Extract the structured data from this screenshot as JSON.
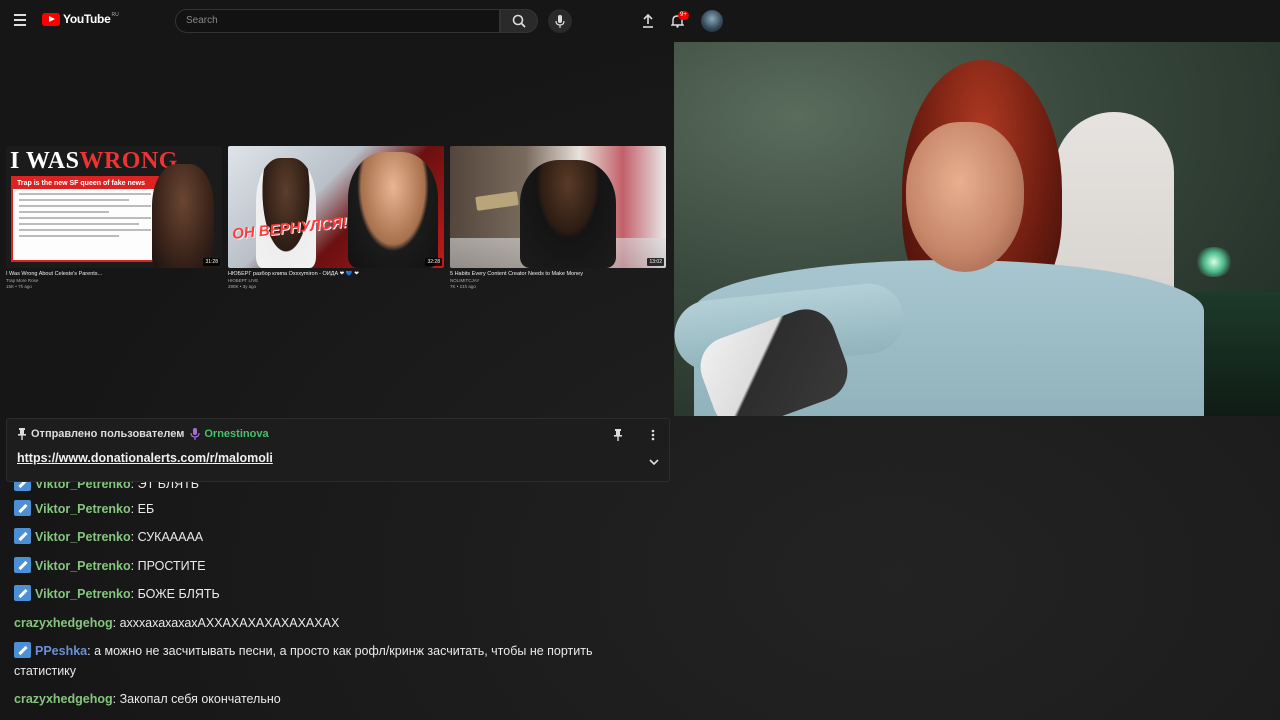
{
  "header": {
    "logo_text": "YouTube",
    "logo_country": "RU",
    "search_placeholder": "Search",
    "notification_badge": "9+"
  },
  "videos": [
    {
      "thumb_headline_1": "I WAS",
      "thumb_headline_2": "WRONG",
      "thumb_doc_header": "Trap is the new SF queen of fake news",
      "duration": "31:28",
      "title": "I Was Wrong About Celeste's Parents...",
      "channel": "Trap More Rose",
      "meta": "15K • 7h ago"
    },
    {
      "thumb_caption": "ОН ВЕРНУЛСЯ!",
      "duration": "32:28",
      "title": "НЮБЕРГ разбор клипа Oxxxymiron - ОЙДА ❤ 💙 ❤",
      "channel": "НЮБЕРГ LIVE",
      "meta": "280K • 3y ago"
    },
    {
      "duration": "13:02",
      "title": "5 Habits Every Content Creator Needs to Make Money",
      "channel": "NOLIMITCJAY",
      "meta": "7K • 21h ago"
    }
  ],
  "pinned": {
    "prefix": "Отправлено пользователем",
    "user": "Ornestinova",
    "link": "https://www.donationalerts.com/r/malomoli"
  },
  "chat": {
    "partial": {
      "user": "Viktor_Petrenko",
      "text": "ЭТ БЛЯТЬ"
    },
    "messages": [
      {
        "user": "Viktor_Petrenko",
        "text": "ЕБ"
      },
      {
        "user": "Viktor_Petrenko",
        "text": "СУКААААА"
      },
      {
        "user": "Viktor_Petrenko",
        "text": "ПРОСТИТЕ"
      },
      {
        "user": "Viktor_Petrenko",
        "text": "БОЖЕ БЛЯТЬ"
      },
      {
        "user": "crazyxhedgehog",
        "text": "ахххахахахахАХХАХАХАХАХАХАХАХ"
      },
      {
        "user": "PPeshka",
        "text": "а можно не засчитывать песни, а просто как рофл/кринж засчитать, чтобы не портить статистику"
      },
      {
        "user": "crazyxhedgehog",
        "text": "Закопал себя окончательно"
      }
    ]
  },
  "colors": {
    "accent_red": "#ff0000",
    "user_green": "#86c57f",
    "user_blue": "#6b8fd6",
    "pinned_user": "#47c06a",
    "mod_badge": "#4d8fd4"
  }
}
